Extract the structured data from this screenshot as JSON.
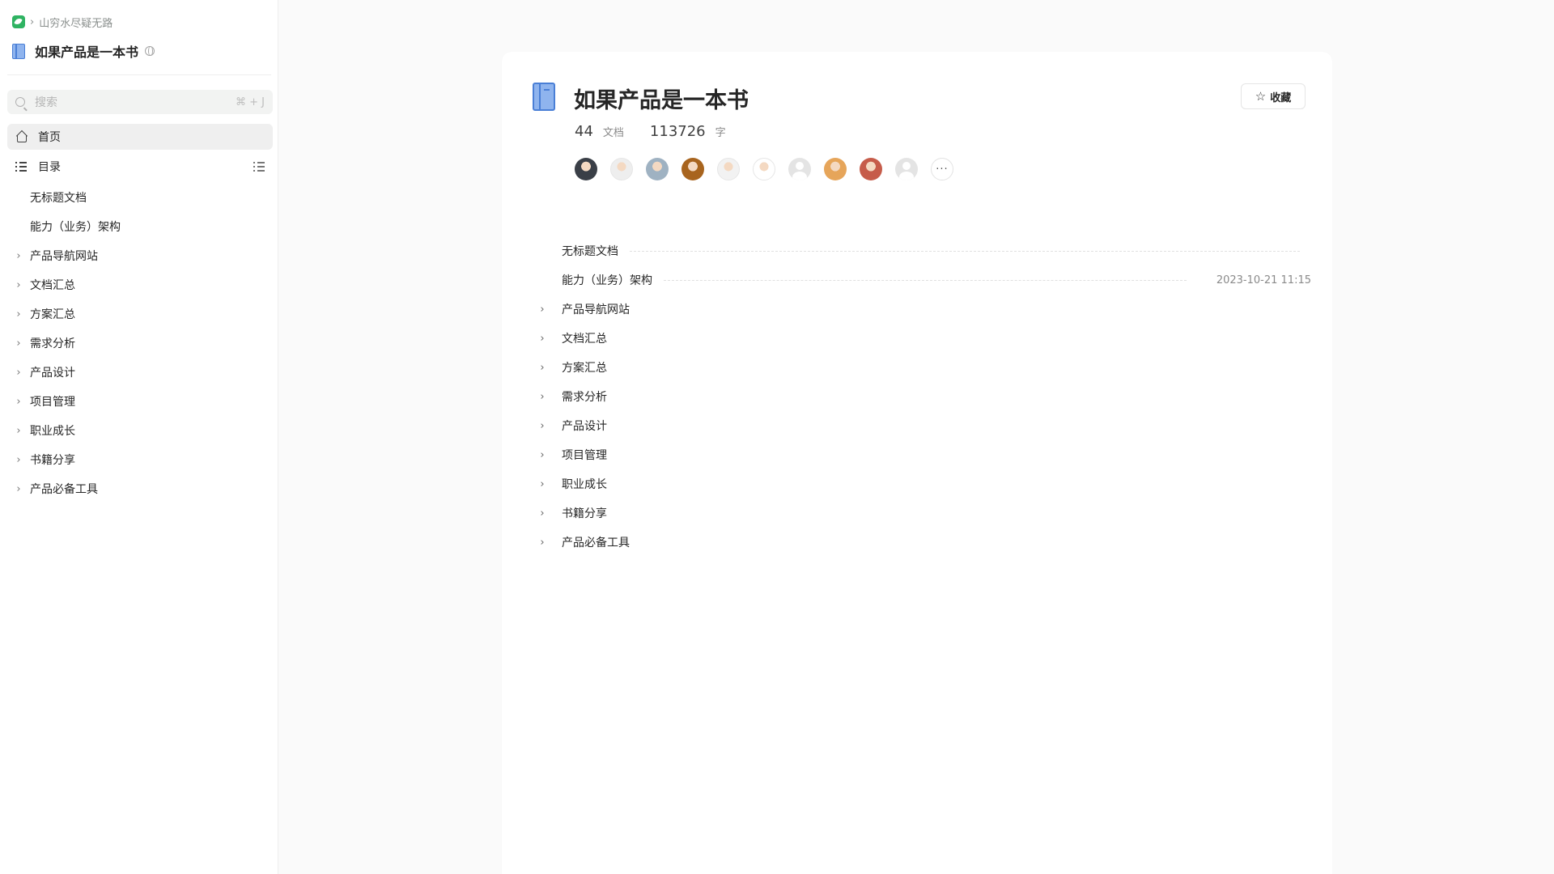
{
  "breadcrumb": {
    "group": "山穷水尽疑无路"
  },
  "book": {
    "title": "如果产品是一本书"
  },
  "search": {
    "placeholder": "搜索",
    "shortcut": "⌘ + J"
  },
  "nav": {
    "home": "首页",
    "toc": "目录"
  },
  "sidebar_tree": [
    {
      "label": "无标题文档",
      "expandable": false
    },
    {
      "label": "能力（业务）架构",
      "expandable": false
    },
    {
      "label": "产品导航网站",
      "expandable": true
    },
    {
      "label": "文档汇总",
      "expandable": true
    },
    {
      "label": "方案汇总",
      "expandable": true
    },
    {
      "label": "需求分析",
      "expandable": true
    },
    {
      "label": "产品设计",
      "expandable": true
    },
    {
      "label": "项目管理",
      "expandable": true
    },
    {
      "label": "职业成长",
      "expandable": true
    },
    {
      "label": "书籍分享",
      "expandable": true
    },
    {
      "label": "产品必备工具",
      "expandable": true
    }
  ],
  "main": {
    "favorite_label": "收藏",
    "stats": {
      "docs_count": "44",
      "docs_unit": "文档",
      "words_count": "113726",
      "words_unit": "字"
    },
    "avatars": [
      {
        "color": "#3a3f47",
        "kind": "photo"
      },
      {
        "color": "#eeeeee",
        "kind": "photo"
      },
      {
        "color": "#9fb2c2",
        "kind": "photo"
      },
      {
        "color": "#a8641e",
        "kind": "photo"
      },
      {
        "color": "#f2f2f2",
        "kind": "photo"
      },
      {
        "color": "#ffffff",
        "kind": "photo"
      },
      {
        "color": "#e4e4e4",
        "kind": "placeholder"
      },
      {
        "color": "#e6a55a",
        "kind": "photo"
      },
      {
        "color": "#c65c4a",
        "kind": "photo"
      },
      {
        "color": "#e4e4e4",
        "kind": "placeholder"
      }
    ],
    "more_label": "···",
    "toc": [
      {
        "label": "无标题文档",
        "expandable": false,
        "date": ""
      },
      {
        "label": "能力（业务）架构",
        "expandable": false,
        "date": "2023-10-21 11:15"
      },
      {
        "label": "产品导航网站",
        "expandable": true,
        "date": ""
      },
      {
        "label": "文档汇总",
        "expandable": true,
        "date": ""
      },
      {
        "label": "方案汇总",
        "expandable": true,
        "date": ""
      },
      {
        "label": "需求分析",
        "expandable": true,
        "date": ""
      },
      {
        "label": "产品设计",
        "expandable": true,
        "date": ""
      },
      {
        "label": "项目管理",
        "expandable": true,
        "date": ""
      },
      {
        "label": "职业成长",
        "expandable": true,
        "date": ""
      },
      {
        "label": "书籍分享",
        "expandable": true,
        "date": ""
      },
      {
        "label": "产品必备工具",
        "expandable": true,
        "date": ""
      }
    ]
  },
  "icons": {
    "app_logo": "yuque-logo-icon",
    "book": "book-icon",
    "search": "search-icon",
    "home": "home-icon",
    "toc": "toc-icon",
    "star": "star-icon",
    "chevron": "chevron-right-icon"
  },
  "colors": {
    "accent_green": "#2fb362",
    "book_blue": "#4a7fd6"
  }
}
